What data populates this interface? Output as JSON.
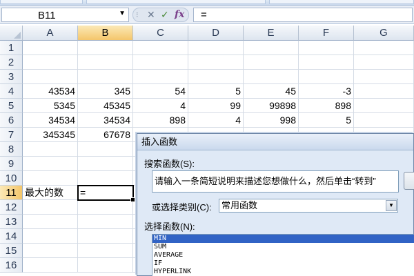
{
  "formula_bar": {
    "name_box": "B11",
    "buttons": [
      "✕",
      "✓",
      "fx"
    ],
    "formula": "="
  },
  "columns": [
    "A",
    "B",
    "C",
    "D",
    "E",
    "F",
    "G"
  ],
  "selected_column": "B",
  "rows": [
    "1",
    "2",
    "3",
    "4",
    "5",
    "6",
    "7",
    "8",
    "9",
    "10",
    "11",
    "12",
    "13",
    "14",
    "15",
    "16"
  ],
  "selected_row": "11",
  "cells": {
    "r4": [
      "43534",
      "345",
      "54",
      "5",
      "45",
      "-3"
    ],
    "r5": [
      "5345",
      "45345",
      "4",
      "99",
      "99898",
      "898"
    ],
    "r6": [
      "34534",
      "34534",
      "898",
      "4",
      "998",
      "5"
    ],
    "r7": [
      "345345",
      "67678",
      "",
      "",
      "",
      ""
    ],
    "a11": "最大的数",
    "b11": "="
  },
  "dialog": {
    "title": "插入函数",
    "search_label": "搜索函数(S):",
    "search_value": "请输入一条简短说明来描述您想做什么，然后单击“转到”",
    "category_label": "或选择类别(C):",
    "category_value": "常用函数",
    "function_label": "选择函数(N):",
    "functions": [
      "MIN",
      "SUM",
      "AVERAGE",
      "IF",
      "HYPERLINK"
    ],
    "selected_function": "MIN"
  },
  "colors": {
    "selection_header": "#f4c66b",
    "list_selection": "#3163c5",
    "dialog_bg": "#dfe9f6"
  }
}
